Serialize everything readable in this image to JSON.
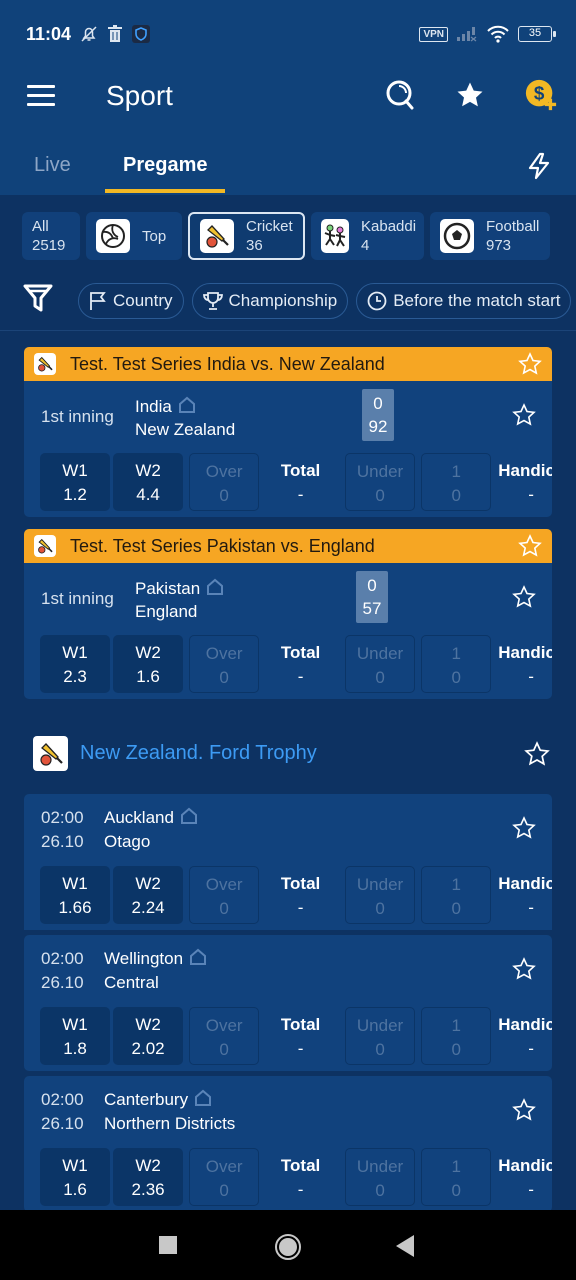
{
  "status_bar": {
    "time": "11:04",
    "vpn_label": "VPN",
    "battery": "35"
  },
  "app_bar": {
    "title": "Sport"
  },
  "tabs": [
    {
      "label": "Live",
      "active": false
    },
    {
      "label": "Pregame",
      "active": true
    }
  ],
  "sports": [
    {
      "name": "All",
      "count": "2519",
      "icon": "none"
    },
    {
      "name": "Top",
      "count": "",
      "icon": "volleyball-icon"
    },
    {
      "name": "Cricket",
      "count": "36",
      "icon": "cricket-icon",
      "active": true
    },
    {
      "name": "Kabaddi",
      "count": "4",
      "icon": "kabaddi-icon"
    },
    {
      "name": "Football",
      "count": "973",
      "icon": "football-icon"
    }
  ],
  "filters": [
    {
      "label": "Country",
      "icon": "flag-icon"
    },
    {
      "label": "Championship",
      "icon": "trophy-icon"
    },
    {
      "label": "Before the match start",
      "icon": "clock-icon"
    }
  ],
  "odds_labels": {
    "w1": "W1",
    "w2": "W2",
    "over": "Over",
    "total": "Total",
    "under": "Under",
    "one": "1",
    "handicap": "Handicap"
  },
  "live_cards": [
    {
      "tournament": "Test. Test Series India vs. New Zealand",
      "period": "1st inning",
      "team1": "India",
      "team2": "New Zealand",
      "score1": "0",
      "score2": "92",
      "odds": {
        "w1": "1.2",
        "w2": "4.4",
        "over": "0",
        "total": "-",
        "under": "0",
        "one": "0",
        "handicap": "-"
      }
    },
    {
      "tournament": "Test. Test Series Pakistan vs. England",
      "period": "1st inning",
      "team1": "Pakistan",
      "team2": "England",
      "score1": "0",
      "score2": "57",
      "odds": {
        "w1": "2.3",
        "w2": "1.6",
        "over": "0",
        "total": "-",
        "under": "0",
        "one": "0",
        "handicap": "-"
      }
    }
  ],
  "league": {
    "title": "New Zealand. Ford Trophy"
  },
  "matches": [
    {
      "time": "02:00",
      "date": "26.10",
      "team1": "Auckland",
      "team2": "Otago",
      "odds": {
        "w1": "1.66",
        "w2": "2.24",
        "over": "0",
        "total": "-",
        "under": "0",
        "one": "0",
        "handicap": "-"
      }
    },
    {
      "time": "02:00",
      "date": "26.10",
      "team1": "Wellington",
      "team2": "Central",
      "odds": {
        "w1": "1.8",
        "w2": "2.02",
        "over": "0",
        "total": "-",
        "under": "0",
        "one": "0",
        "handicap": "-"
      }
    },
    {
      "time": "02:00",
      "date": "26.10",
      "team1": "Canterbury",
      "team2": "Northern Districts",
      "odds": {
        "w1": "1.6",
        "w2": "2.36",
        "over": "0",
        "total": "-",
        "under": "0",
        "one": "0",
        "handicap": "-"
      }
    }
  ],
  "colors": {
    "accent_yellow": "#f6a623",
    "tab_underline": "#f2b824",
    "league_blue": "#3d9bf4",
    "bg": "#0d3262",
    "card": "#11427d"
  }
}
